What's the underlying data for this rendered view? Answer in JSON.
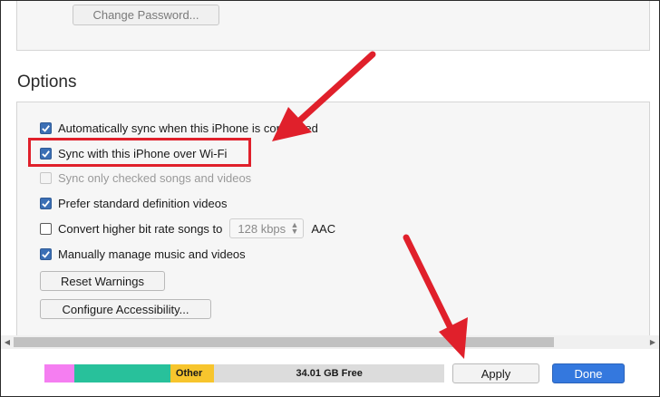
{
  "security": {
    "change_password_label": "Change Password..."
  },
  "options": {
    "title": "Options",
    "items": [
      {
        "label": "Automatically sync when this iPhone is connected",
        "checked": true,
        "enabled": true
      },
      {
        "label": "Sync with this iPhone over Wi-Fi",
        "checked": true,
        "enabled": true
      },
      {
        "label": "Sync only checked songs and videos",
        "checked": false,
        "enabled": false
      },
      {
        "label": "Prefer standard definition videos",
        "checked": true,
        "enabled": true
      },
      {
        "label": "Convert higher bit rate songs to",
        "checked": false,
        "enabled": true
      },
      {
        "label": "Manually manage music and videos",
        "checked": true,
        "enabled": true
      }
    ],
    "bitrate": {
      "value": "128 kbps",
      "format": "AAC"
    },
    "reset_warnings_label": "Reset Warnings",
    "configure_accessibility_label": "Configure Accessibility..."
  },
  "storage": {
    "segments": [
      {
        "label": "",
        "color": "#f57ef1",
        "share": 0.075
      },
      {
        "label": "",
        "color": "#28c19b",
        "share": 0.24
      },
      {
        "label": "Other",
        "color": "#f7c52d",
        "share": 0.11
      },
      {
        "label": "34.01 GB Free",
        "color": "#dcdcdc",
        "share": 0.575
      }
    ]
  },
  "footer": {
    "apply_label": "Apply",
    "done_label": "Done"
  },
  "colors": {
    "accent": "#3478de",
    "annotation": "#e0202b"
  }
}
